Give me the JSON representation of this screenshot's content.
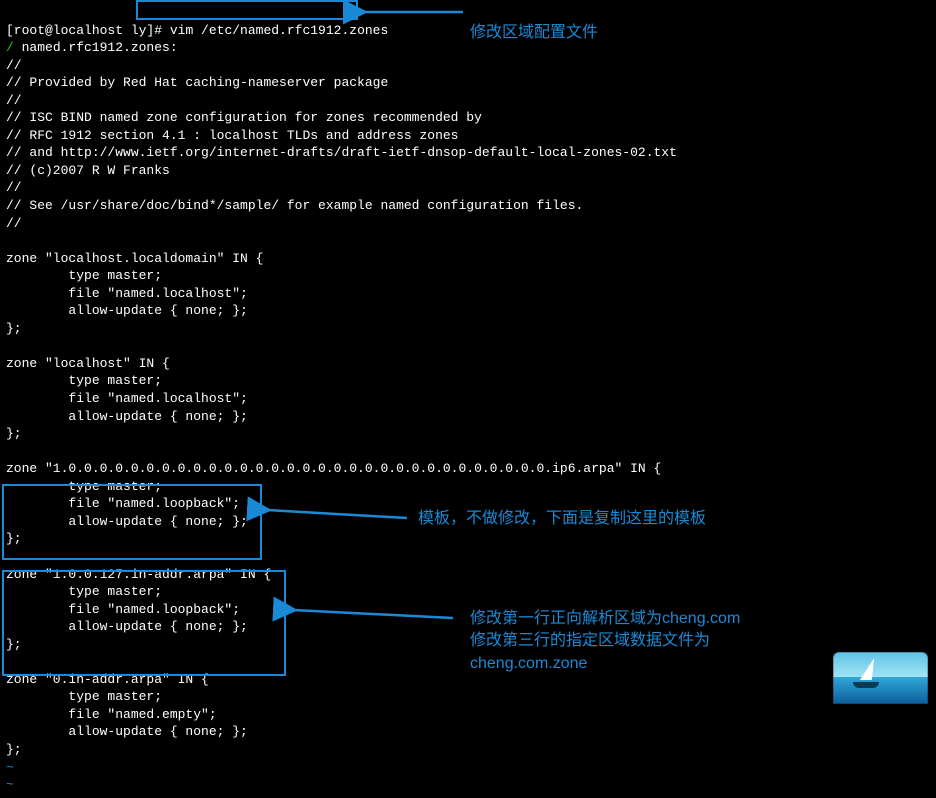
{
  "prompt": "[root@localhost ly]",
  "command": "# vim /etc/named.rfc1912.zones",
  "file_head_marker": "/",
  "file_header": [
    " named.rfc1912.zones:",
    "//",
    "// Provided by Red Hat caching-nameserver package",
    "//",
    "// ISC BIND named zone configuration for zones recommended by",
    "// RFC 1912 section 4.1 : localhost TLDs and address zones",
    "// and http://www.ietf.org/internet-drafts/draft-ietf-dnsop-default-local-zones-02.txt",
    "// (c)2007 R W Franks",
    "//",
    "// See /usr/share/doc/bind*/sample/ for example named configuration files.",
    "//"
  ],
  "zones": [
    {
      "open": "zone \"localhost.localdomain\" IN {",
      "body": [
        "        type master;",
        "        file \"named.localhost\";",
        "        allow-update { none; };"
      ],
      "close": "};"
    },
    {
      "open": "zone \"localhost\" IN {",
      "body": [
        "        type master;",
        "        file \"named.localhost\";",
        "        allow-update { none; };"
      ],
      "close": "};"
    },
    {
      "open": "zone \"1.0.0.0.0.0.0.0.0.0.0.0.0.0.0.0.0.0.0.0.0.0.0.0.0.0.0.0.0.0.0.0.ip6.arpa\" IN {",
      "body": [
        "        type master;",
        "        file \"named.loopback\";",
        "        allow-update { none; };"
      ],
      "close": "};"
    },
    {
      "open": "zone \"1.0.0.127.in-addr.arpa\" IN {",
      "body": [
        "        type master;",
        "        file \"named.loopback\";",
        "        allow-update { none; };"
      ],
      "close": "};"
    },
    {
      "open": "zone \"0.in-addr.arpa\" IN {",
      "body": [
        "        type master;",
        "        file \"named.empty\";",
        "        allow-update { none; };"
      ],
      "close": "};"
    }
  ],
  "tildes": [
    "~",
    "~"
  ],
  "annotations": {
    "top": "修改区域配置文件",
    "middle": "模板，不做修改，下面是复制这里的模板",
    "bottom_line1": "修改第一行正向解析区域为cheng.com",
    "bottom_line2": "修改第三行的指定区域数据文件为",
    "bottom_line3": "cheng.com.zone"
  }
}
